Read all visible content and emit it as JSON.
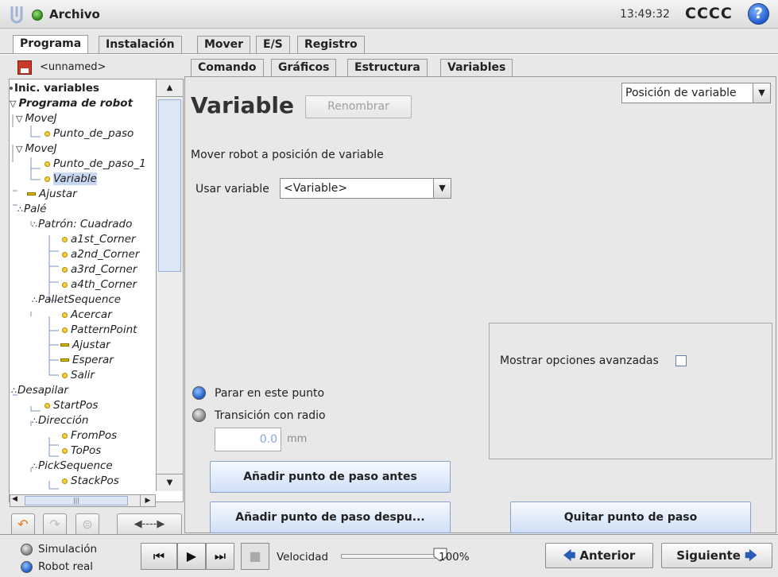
{
  "header": {
    "app_title": "Archivo",
    "clock": "13:49:32",
    "robot_name": "CCCC",
    "help_glyph": "?"
  },
  "main_tabs": [
    "Programa",
    "Instalación",
    "Mover",
    "E/S",
    "Registro"
  ],
  "program": {
    "name": "<unnamed>"
  },
  "tree": [
    {
      "label": "Inic. variables"
    },
    {
      "label": "Programa de robot"
    },
    {
      "label": "MoveJ"
    },
    {
      "label": "Punto_de_paso"
    },
    {
      "label": "MoveJ"
    },
    {
      "label": "Punto_de_paso_1"
    },
    {
      "label": "Variable"
    },
    {
      "label": "Ajustar"
    },
    {
      "label": "Palé"
    },
    {
      "label": "Patrón: Cuadrado"
    },
    {
      "label": "a1st_Corner"
    },
    {
      "label": "a2nd_Corner"
    },
    {
      "label": "a3rd_Corner"
    },
    {
      "label": "a4th_Corner"
    },
    {
      "label": "PalletSequence"
    },
    {
      "label": "Acercar"
    },
    {
      "label": "PatternPoint"
    },
    {
      "label": "Ajustar"
    },
    {
      "label": "Esperar"
    },
    {
      "label": "Salir"
    },
    {
      "label": "Desapilar"
    },
    {
      "label": "StartPos"
    },
    {
      "label": "Dirección"
    },
    {
      "label": "FromPos"
    },
    {
      "label": "ToPos"
    },
    {
      "label": "PickSequence"
    },
    {
      "label": "StackPos"
    }
  ],
  "sub_tabs": [
    "Comando",
    "Gráficos",
    "Estructura",
    "Variables"
  ],
  "command": {
    "title": "Variable",
    "rename_label": "Renombrar",
    "position_type": "Posición de variable",
    "description": "Mover robot a posición de variable",
    "use_variable_label": "Usar variable",
    "use_variable_value": "<Variable>",
    "stop_here": "Parar en este punto",
    "blend_radius": "Transición con radio",
    "radius_value": "0.0",
    "radius_unit": "mm",
    "add_before": "Añadir punto de paso antes",
    "add_after": "Añadir punto de paso despu...",
    "remove": "Quitar punto de paso",
    "advanced_options": "Mostrar opciones avanzadas",
    "advanced_checked": false
  },
  "bottom": {
    "simulation": "Simulación",
    "real_robot": "Robot real",
    "speed_label": "Velocidad",
    "speed_value": "100%",
    "speed_fraction": 1.0,
    "prev": "Anterior",
    "next": "Siguiente"
  }
}
